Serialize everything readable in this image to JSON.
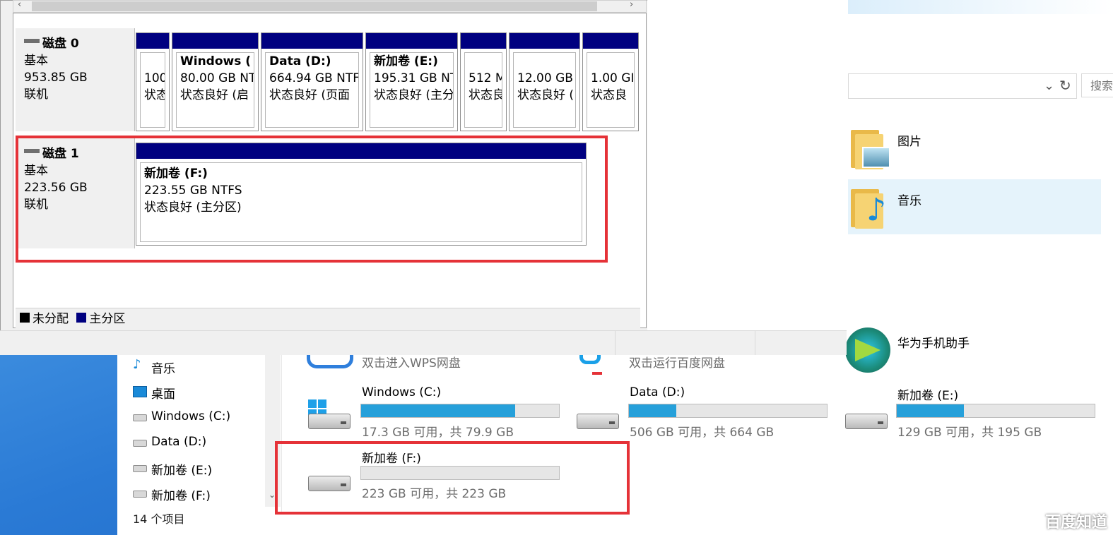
{
  "disk_mgmt": {
    "disk0": {
      "title": "磁盘 0",
      "type": "基本",
      "size": "953.85 GB",
      "status": "联机",
      "partitions": [
        {
          "line1": "",
          "line2": "100",
          "line3": "状态"
        },
        {
          "line1": "Windows (",
          "line2": "80.00 GB NT",
          "line3": "状态良好 (启"
        },
        {
          "line1": "Data (D:)",
          "line2": "664.94 GB NTF",
          "line3": "状态良好 (页面"
        },
        {
          "line1": "新加卷 (E:)",
          "line2": "195.31 GB NT",
          "line3": "状态良好 (主分"
        },
        {
          "line1": "",
          "line2": "512 M",
          "line3": "状态良"
        },
        {
          "line1": "",
          "line2": "12.00 GB",
          "line3": "状态良好 ("
        },
        {
          "line1": "",
          "line2": "1.00 GI",
          "line3": "状态良"
        }
      ]
    },
    "disk1": {
      "title": "磁盘 1",
      "type": "基本",
      "size": "223.56 GB",
      "status": "联机",
      "partition": {
        "line1": "新加卷 (F:)",
        "line2": "223.55 GB NTFS",
        "line3": "状态良好 (主分区)"
      }
    },
    "legend": {
      "unallocated": "未分配",
      "primary": "主分区"
    },
    "colors": {
      "primary": "#000080",
      "unallocated": "#000000",
      "highlight": "#e53238"
    }
  },
  "explorer": {
    "search_placeholder": "搜索",
    "folders": [
      {
        "label": "图片",
        "icon": "pictures-folder-icon"
      },
      {
        "label": "音乐",
        "icon": "music-folder-icon"
      }
    ],
    "apps": [
      {
        "label": "双击进入WPS网盘"
      },
      {
        "label": "双击运行百度网盘"
      },
      {
        "label": "华为手机助手"
      }
    ],
    "nav": [
      {
        "label": "音乐",
        "icon": "music-note-icon"
      },
      {
        "label": "桌面",
        "icon": "desktop-icon"
      },
      {
        "label": "Windows (C:)",
        "icon": "windows-drive-icon"
      },
      {
        "label": "Data (D:)",
        "icon": "drive-icon"
      },
      {
        "label": "新加卷 (E:)",
        "icon": "drive-icon"
      },
      {
        "label": "新加卷 (F:)",
        "icon": "drive-icon"
      }
    ],
    "drives": [
      {
        "name": "Windows (C:)",
        "free": "17.3 GB 可用，共 79.9 GB",
        "used_fraction": 0.78
      },
      {
        "name": "Data (D:)",
        "free": "506 GB 可用，共 664 GB",
        "used_fraction": 0.24
      },
      {
        "name": "新加卷 (E:)",
        "free": "129 GB 可用，共 195 GB",
        "used_fraction": 0.34
      },
      {
        "name": "新加卷 (F:)",
        "free": "223 GB 可用，共 223 GB",
        "used_fraction": 0.0
      }
    ],
    "item_count": "14 个项目"
  },
  "watermark": "百度知道"
}
